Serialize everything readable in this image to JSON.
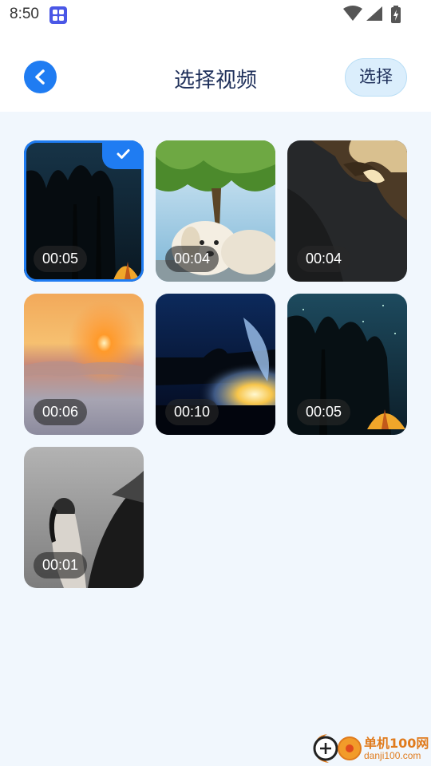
{
  "status_bar": {
    "time": "8:50",
    "app_icon": "grid-app-icon",
    "icons": [
      "wifi-icon",
      "cell-signal-icon",
      "battery-charging-icon"
    ]
  },
  "header": {
    "back_icon": "chevron-left-icon",
    "title": "选择视频",
    "select_label": "选择",
    "accent_color": "#1f7cf2"
  },
  "videos": [
    {
      "duration": "00:05",
      "selected": true,
      "scene": "night-forest-tent"
    },
    {
      "duration": "00:04",
      "selected": false,
      "scene": "puppy-under-tree"
    },
    {
      "duration": "00:04",
      "selected": false,
      "scene": "dark-painting"
    },
    {
      "duration": "00:06",
      "selected": false,
      "scene": "sunset-over-clouds"
    },
    {
      "duration": "00:10",
      "selected": false,
      "scene": "blue-explosion"
    },
    {
      "duration": "00:05",
      "selected": false,
      "scene": "starry-forest-tent"
    },
    {
      "duration": "00:01",
      "selected": false,
      "scene": "woman-with-horse"
    }
  ],
  "watermark": {
    "name": "单机100网",
    "url": "danji100.com"
  }
}
